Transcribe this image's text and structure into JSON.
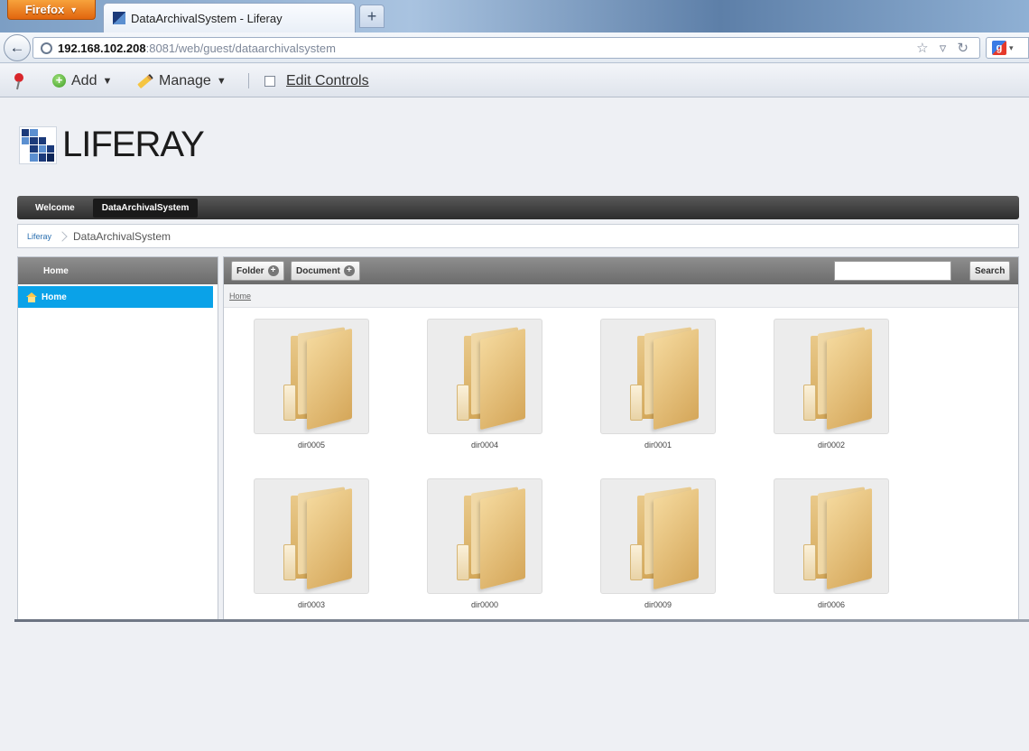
{
  "browser": {
    "app_button": "Firefox",
    "tab_title": "DataArchivalSystem - Liferay",
    "url_host": "192.168.102.208",
    "url_rest": ":8081/web/guest/dataarchivalsystem"
  },
  "dockbar": {
    "add_label": "Add",
    "manage_label": "Manage",
    "edit_controls_label": "Edit Controls"
  },
  "logo": {
    "text": "LIFERAY"
  },
  "site_nav": {
    "items": [
      {
        "label": "Welcome"
      },
      {
        "label": "DataArchivalSystem"
      }
    ]
  },
  "breadcrumb": {
    "home": "Liferay",
    "current": "DataArchivalSystem"
  },
  "sidebar": {
    "header": "Home",
    "items": [
      {
        "label": "Home"
      }
    ]
  },
  "main": {
    "folder_button": "Folder",
    "document_button": "Document",
    "search_button": "Search",
    "search_value": "",
    "crumb": "Home",
    "folders": [
      "dir0005",
      "dir0004",
      "dir0001",
      "dir0002",
      "dir0003",
      "dir0000",
      "dir0009",
      "dir0006"
    ]
  }
}
